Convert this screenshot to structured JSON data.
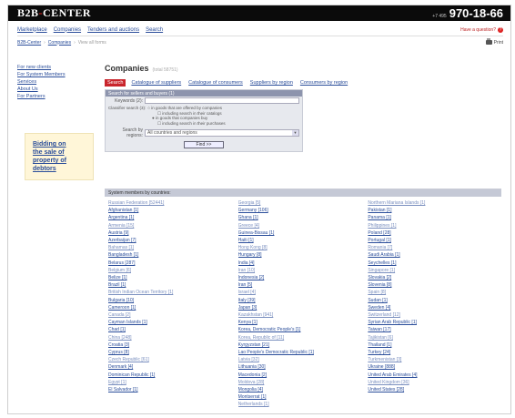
{
  "header": {
    "logo_a": "B2B",
    "logo_dash": "-",
    "logo_b": "CENTER",
    "phone_code": "+7 495",
    "phone_number": "970-18-66"
  },
  "nav": {
    "links": [
      "Marketplace",
      "Companies",
      "Tenders and auctions",
      "Search"
    ],
    "right_link": "Have a question?",
    "right_icon": "?"
  },
  "breadcrumbs": {
    "items": [
      "B2B-Center",
      "Companies",
      "View all forms"
    ],
    "print_label": "Print"
  },
  "sidebar": {
    "links": [
      "For new clients",
      "For System Members",
      "Services",
      "About Us",
      "For Partners"
    ],
    "promo_lines": [
      "Bidding on",
      "the sale of",
      "property of",
      "debtors"
    ]
  },
  "main": {
    "title": "Companies",
    "subtitle": "(total 58751)",
    "tabs": [
      "Search",
      "Catalogue of suppliers",
      "Catalogue of consumers",
      "Suppliers by region",
      "Consumers by region"
    ],
    "search": {
      "heading": "Search for sellers and buyers (1)",
      "keywords_label": "Keywords (2):",
      "keywords_value": "",
      "classifier_label": "Classifier search (3):",
      "radio1": "in goods that are offered by companies",
      "radio1_sub": "including search in their catalogs",
      "radio2": "in goods that companies buy",
      "radio2_sub": "including search in their purchases",
      "region_label": "Search by regions:",
      "region_value": "All countries and regions",
      "find_button": "Find >>"
    }
  },
  "countries": {
    "heading": "System members by countries:",
    "col1": [
      "Russian Federation [52441]",
      "Afghanistan [1]",
      "Argentina [1]",
      "Armenia [15]",
      "Austria [9]",
      "Azerbaijan [7]",
      "Bahamas [1]",
      "Bangladesh [1]",
      "Belarus [287]",
      "Belgium [6]",
      "Belize [1]",
      "Brazil [1]",
      "British Indian Ocean Territory [1]",
      "Bulgaria [10]",
      "Cameroon [1]",
      "Canada [2]",
      "Cayman Islands [1]",
      "Chad [1]",
      "China [248]",
      "Croatia [3]",
      "Cyprus [8]",
      "Czech Republic [61]",
      "Denmark [4]",
      "Dominican Republic [1]",
      "Egypt [1]",
      "El Salvador [1]"
    ],
    "col2": [
      "Georgia [5]",
      "Germany [106]",
      "Ghana [1]",
      "Greece [4]",
      "Guinea-Bissau [1]",
      "Haiti [1]",
      "Hong Kong [8]",
      "Hungary [8]",
      "India [4]",
      "Iran [10]",
      "Indonesia [2]",
      "Iran [5]",
      "Israel [4]",
      "Italy [39]",
      "Japan [3]",
      "Kazakhstan [941]",
      "Kenya [1]",
      "Korea, Democratic People's [1]",
      "Korea, Republic of [11]",
      "Kyrgyzstan [21]",
      "Lao People's Democratic Republic [1]",
      "Latvia [32]",
      "Lithuania [30]",
      "Macedonia [2]",
      "Moldova [28]",
      "Mongolia [4]",
      "Montserrat [1]",
      "Netherlands [1]"
    ],
    "col3": [
      "Northern Mariana Islands [1]",
      "Pakistan [1]",
      "Panama [1]",
      "Philippines [1]",
      "Poland [28]",
      "Portugal [1]",
      "Romania [7]",
      "Saudi Arabia [1]",
      "Seychelles [1]",
      "Singapore [1]",
      "Slovakia [2]",
      "Slovenia [8]",
      "Spain [8]",
      "Sudan [1]",
      "Sweden [4]",
      "Switzerland [12]",
      "Syrian Arab Republic [1]",
      "Taiwan [17]",
      "Tajikistan [6]",
      "Thailand [1]",
      "Turkey [24]",
      "Turkmenistan [3]",
      "Ukraine [888]",
      "United Arab Emirates [4]",
      "United Kingdom [36]",
      "United States [28]"
    ]
  }
}
